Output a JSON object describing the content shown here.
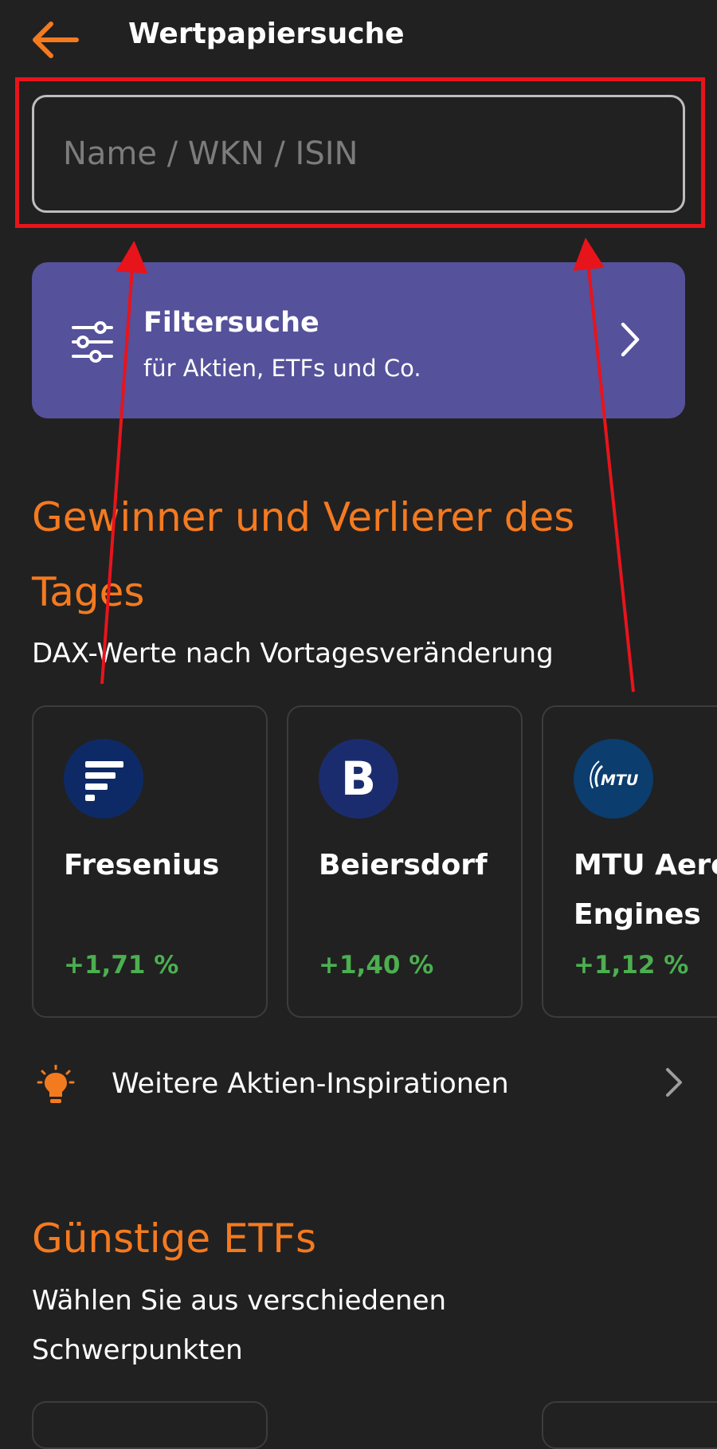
{
  "header": {
    "title": "Wertpapiersuche",
    "back_icon": "arrow-left-icon"
  },
  "search": {
    "placeholder": "Name / WKN / ISIN",
    "value": ""
  },
  "filter_card": {
    "title": "Filtersuche",
    "subtitle": "für Aktien, ETFs und Co.",
    "icon": "sliders-icon",
    "chevron": "chevron-right-icon"
  },
  "movers": {
    "title_line1": "Gewinner und Verlierer des",
    "title_line2": "Tages",
    "subtitle": "DAX-Werte nach Vortagesveränderung",
    "cards": [
      {
        "name": "Fresenius",
        "name_line2": "",
        "change": "+1,71 %",
        "logo": "fresenius-logo"
      },
      {
        "name": "Beiersdorf",
        "name_line2": "",
        "change": "+1,40 %",
        "logo": "beiersdorf-logo",
        "logo_letter": "B"
      },
      {
        "name": "MTU Aero",
        "name_line2": "Engines",
        "change": "+1,12 %",
        "logo": "mtu-logo",
        "logo_text": "MTU"
      }
    ]
  },
  "more_stocks": {
    "label": "Weitere Aktien-Inspirationen",
    "icon": "lightbulb-icon",
    "chevron": "chevron-right-icon"
  },
  "etfs": {
    "title": "Günstige ETFs",
    "subtitle_line1": "Wählen Sie aus verschiedenen",
    "subtitle_line2": "Schwerpunkten"
  },
  "colors": {
    "accent": "#f47a20",
    "background": "#212121",
    "filter_card": "#55519b",
    "positive": "#4caf50",
    "annotation_red": "#e8141b"
  }
}
